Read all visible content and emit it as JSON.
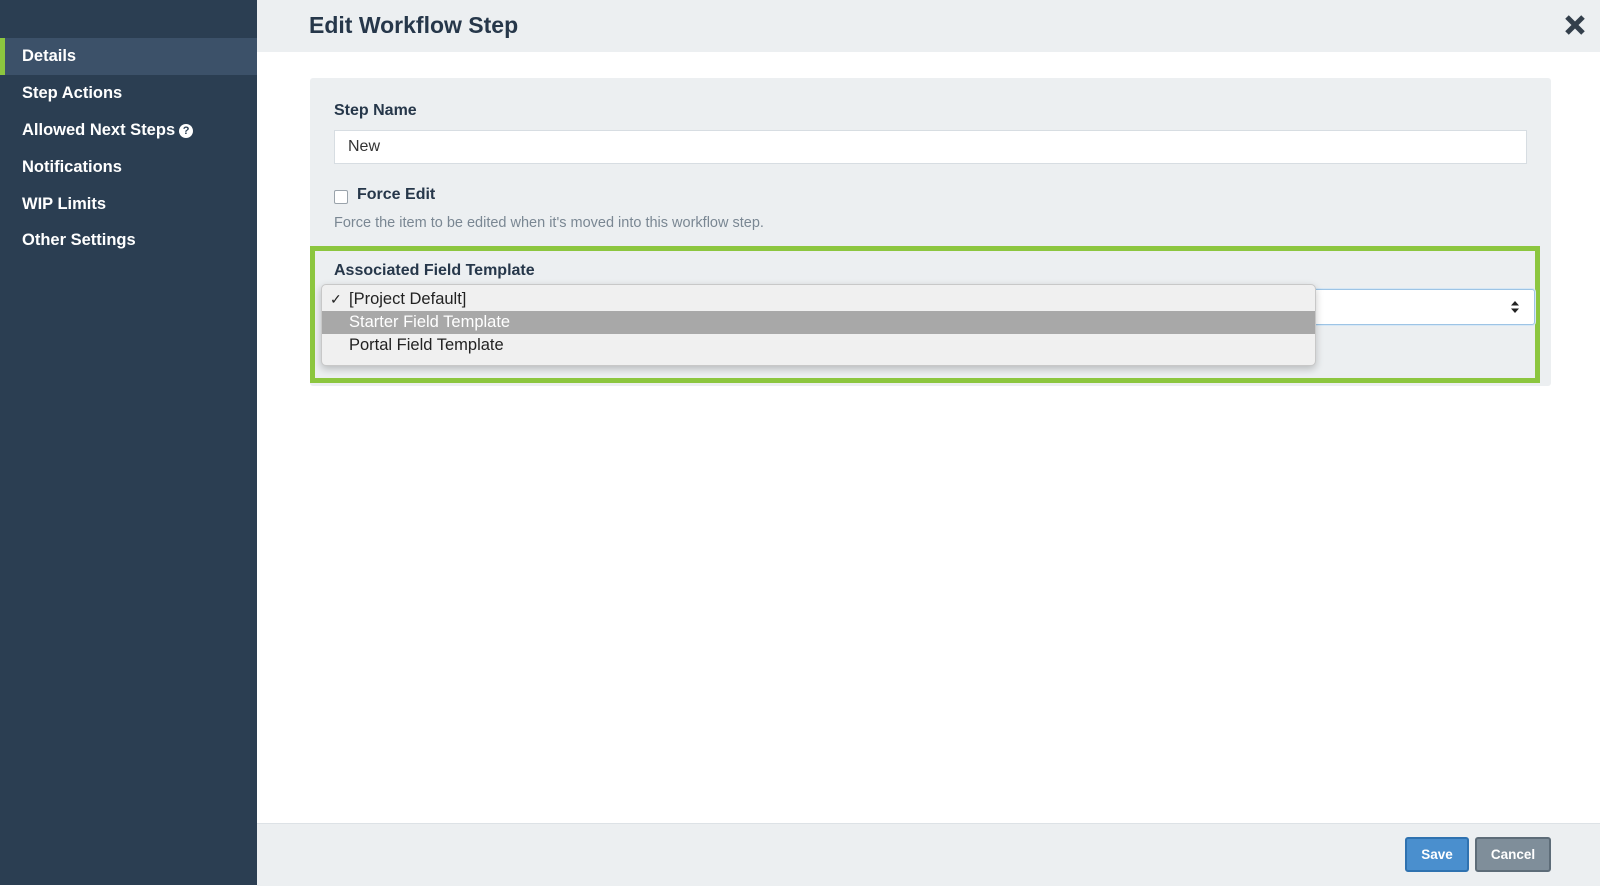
{
  "sidebar": {
    "items": [
      {
        "label": "Details",
        "active": true
      },
      {
        "label": "Step Actions"
      },
      {
        "label": "Allowed Next Steps",
        "help_icon": "question-circle-icon"
      },
      {
        "label": "Notifications"
      },
      {
        "label": "WIP Limits"
      },
      {
        "label": "Other Settings"
      }
    ]
  },
  "header": {
    "title": "Edit Workflow Step",
    "close_icon": "close-x-icon"
  },
  "form": {
    "step_name_label": "Step Name",
    "step_name_value": "New",
    "force_edit_label": "Force Edit",
    "force_edit_checked": false,
    "force_edit_help": "Force the item to be edited when it's moved into this workflow step.",
    "field_template_label": "Associated Field Template",
    "field_template_selected": "[Project Default]",
    "field_template_options": [
      {
        "label": "[Project Default]",
        "checked": true
      },
      {
        "label": "Starter Field Template",
        "highlighted": true
      },
      {
        "label": "Portal Field Template"
      }
    ]
  },
  "footer": {
    "save_label": "Save",
    "cancel_label": "Cancel"
  },
  "colors": {
    "sidebar_bg": "#2b3e52",
    "accent_green": "#8cc63f",
    "save_blue": "#4a8fce",
    "cancel_gray": "#7f8e9a"
  }
}
